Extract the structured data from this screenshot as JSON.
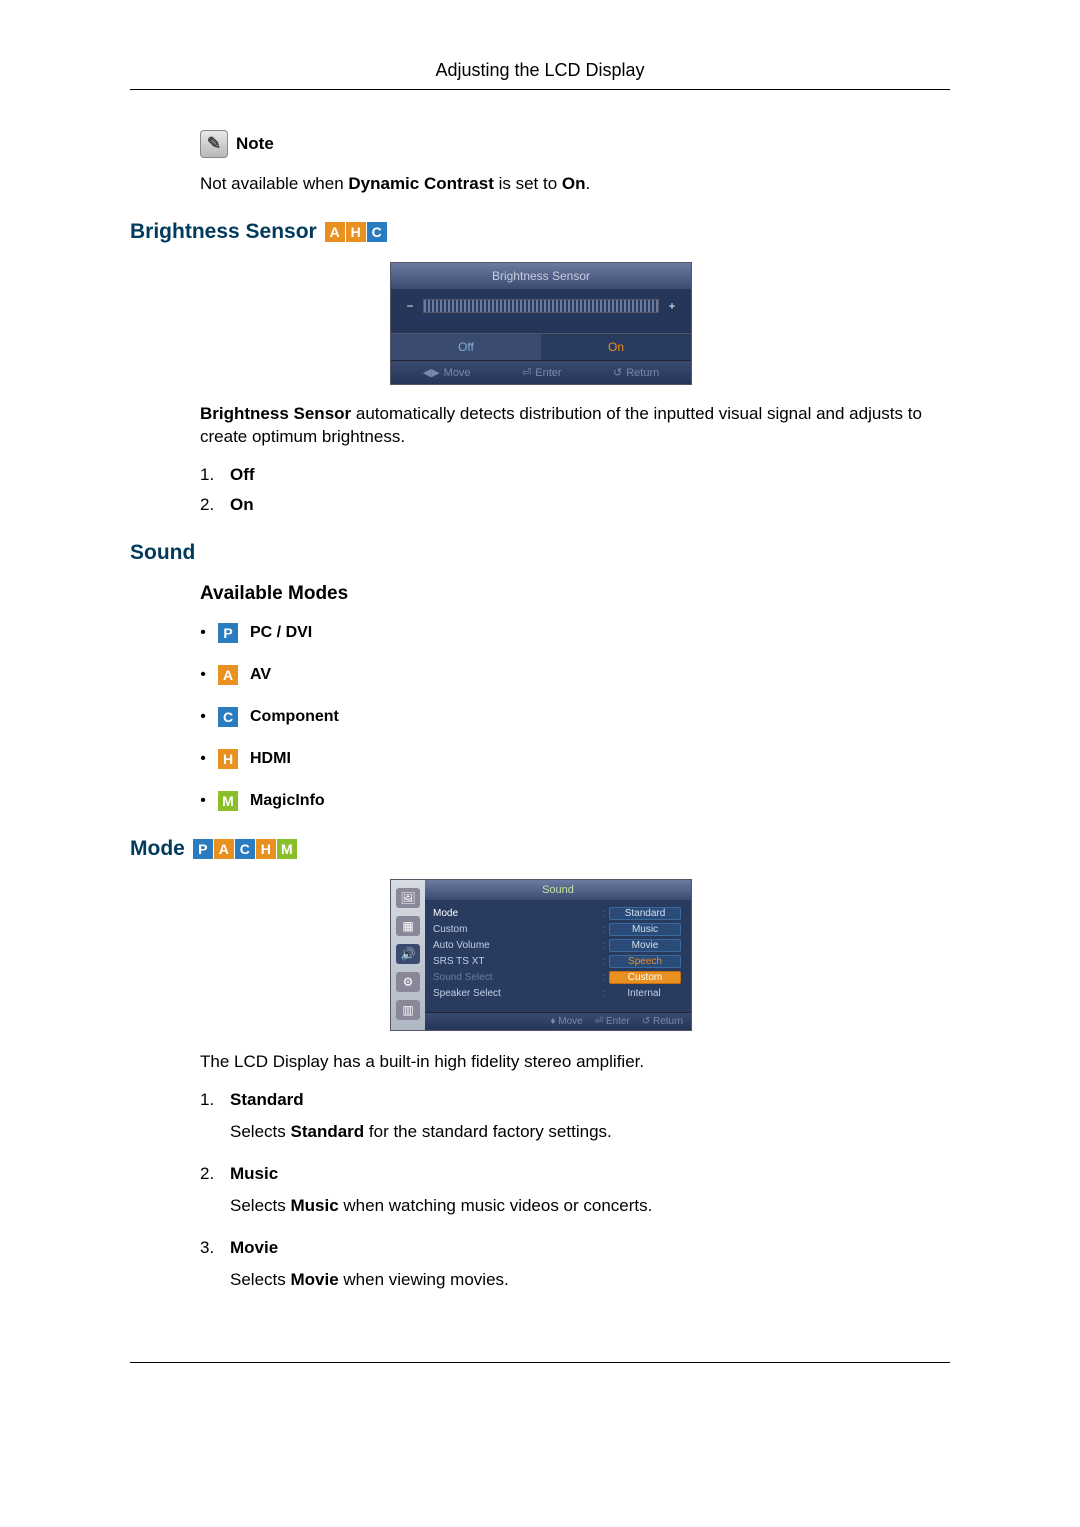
{
  "header": {
    "title": "Adjusting the LCD Display"
  },
  "note": {
    "label": "Note",
    "text_pre": "Not available when ",
    "text_bold1": "Dynamic Contrast",
    "text_mid": " is set to ",
    "text_bold2": "On",
    "text_post": "."
  },
  "brightness_sensor": {
    "heading": "Brightness Sensor",
    "tags": [
      "A",
      "H",
      "C"
    ],
    "osd": {
      "title": "Brightness Sensor",
      "minus": "−",
      "plus": "+",
      "off": "Off",
      "on": "On",
      "footer": {
        "move": "Move",
        "enter": "Enter",
        "return": "Return"
      }
    },
    "desc_bold": "Brightness Sensor",
    "desc_rest": " automatically detects distribution of the inputted visual signal and adjusts to create optimum brightness.",
    "options": [
      {
        "num": "1.",
        "label": "Off"
      },
      {
        "num": "2.",
        "label": "On"
      }
    ]
  },
  "sound": {
    "heading": "Sound",
    "available_modes_heading": "Available Modes",
    "modes": [
      {
        "tag": "P",
        "cls": "tag-P",
        "label": "PC / DVI"
      },
      {
        "tag": "A",
        "cls": "tag-A",
        "label": "AV"
      },
      {
        "tag": "C",
        "cls": "tag-C",
        "label": "Component"
      },
      {
        "tag": "H",
        "cls": "tag-H",
        "label": "HDMI"
      },
      {
        "tag": "M",
        "cls": "tag-M",
        "label": "MagicInfo"
      }
    ]
  },
  "mode": {
    "heading": "Mode",
    "tags": [
      {
        "t": "P",
        "c": "tag-P"
      },
      {
        "t": "A",
        "c": "tag-A"
      },
      {
        "t": "C",
        "c": "tag-C"
      },
      {
        "t": "H",
        "c": "tag-H"
      },
      {
        "t": "M",
        "c": "tag-M"
      }
    ],
    "osd": {
      "title": "Sound",
      "rows": {
        "mode": {
          "label": "Mode",
          "value": "Standard"
        },
        "custom": {
          "label": "Custom",
          "value": "Music"
        },
        "auto_volume": {
          "label": "Auto Volume",
          "value": "Movie"
        },
        "srs": {
          "label": "SRS TS XT",
          "value": "Speech"
        },
        "sound_select": {
          "label": "Sound Select",
          "value": "Custom"
        },
        "speaker_select": {
          "label": "Speaker Select",
          "value": "Internal"
        }
      },
      "colon": ":",
      "footer": {
        "move": "Move",
        "enter": "Enter",
        "return": "Return"
      }
    },
    "intro": "The LCD Display has a built-in high fidelity stereo amplifier.",
    "items": [
      {
        "num": "1.",
        "title": "Standard",
        "desc_pre": "Selects ",
        "desc_bold": "Standard",
        "desc_post": " for the standard factory settings."
      },
      {
        "num": "2.",
        "title": "Music",
        "desc_pre": "Selects ",
        "desc_bold": "Music",
        "desc_post": " when watching music videos or concerts."
      },
      {
        "num": "3.",
        "title": "Movie",
        "desc_pre": "Selects ",
        "desc_bold": "Movie",
        "desc_post": " when viewing movies."
      }
    ]
  }
}
